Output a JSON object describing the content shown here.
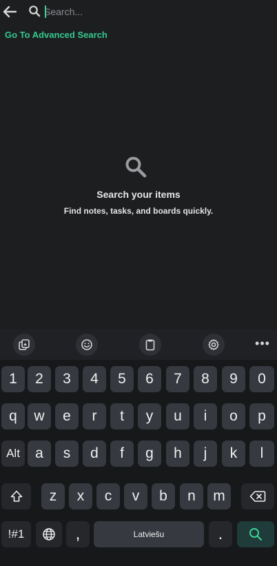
{
  "search": {
    "placeholder": "Search...",
    "value": ""
  },
  "advanced_link": "Go To Advanced Search",
  "empty_state": {
    "icon": "search-icon",
    "title": "Search your items",
    "subtitle": "Find notes, tasks, and boards quickly."
  },
  "keyboard": {
    "toolbar": [
      "sticker-icon",
      "emoji-icon",
      "clipboard-icon",
      "settings-icon",
      "more-icon"
    ],
    "more_label": "•••",
    "row1": [
      "1",
      "2",
      "3",
      "4",
      "5",
      "6",
      "7",
      "8",
      "9",
      "0"
    ],
    "row2": [
      "q",
      "w",
      "e",
      "r",
      "t",
      "y",
      "u",
      "i",
      "o",
      "p"
    ],
    "row3": [
      "Alt",
      "a",
      "s",
      "d",
      "f",
      "g",
      "h",
      "j",
      "k",
      "l"
    ],
    "row4": [
      "z",
      "x",
      "c",
      "v",
      "b",
      "n",
      "m"
    ],
    "symbols_label": "!#1",
    "comma": ",",
    "space_label": "Latviešu",
    "period": "."
  },
  "colors": {
    "accent": "#34c98f",
    "background": "#1d1e20",
    "key": "#36393f"
  }
}
